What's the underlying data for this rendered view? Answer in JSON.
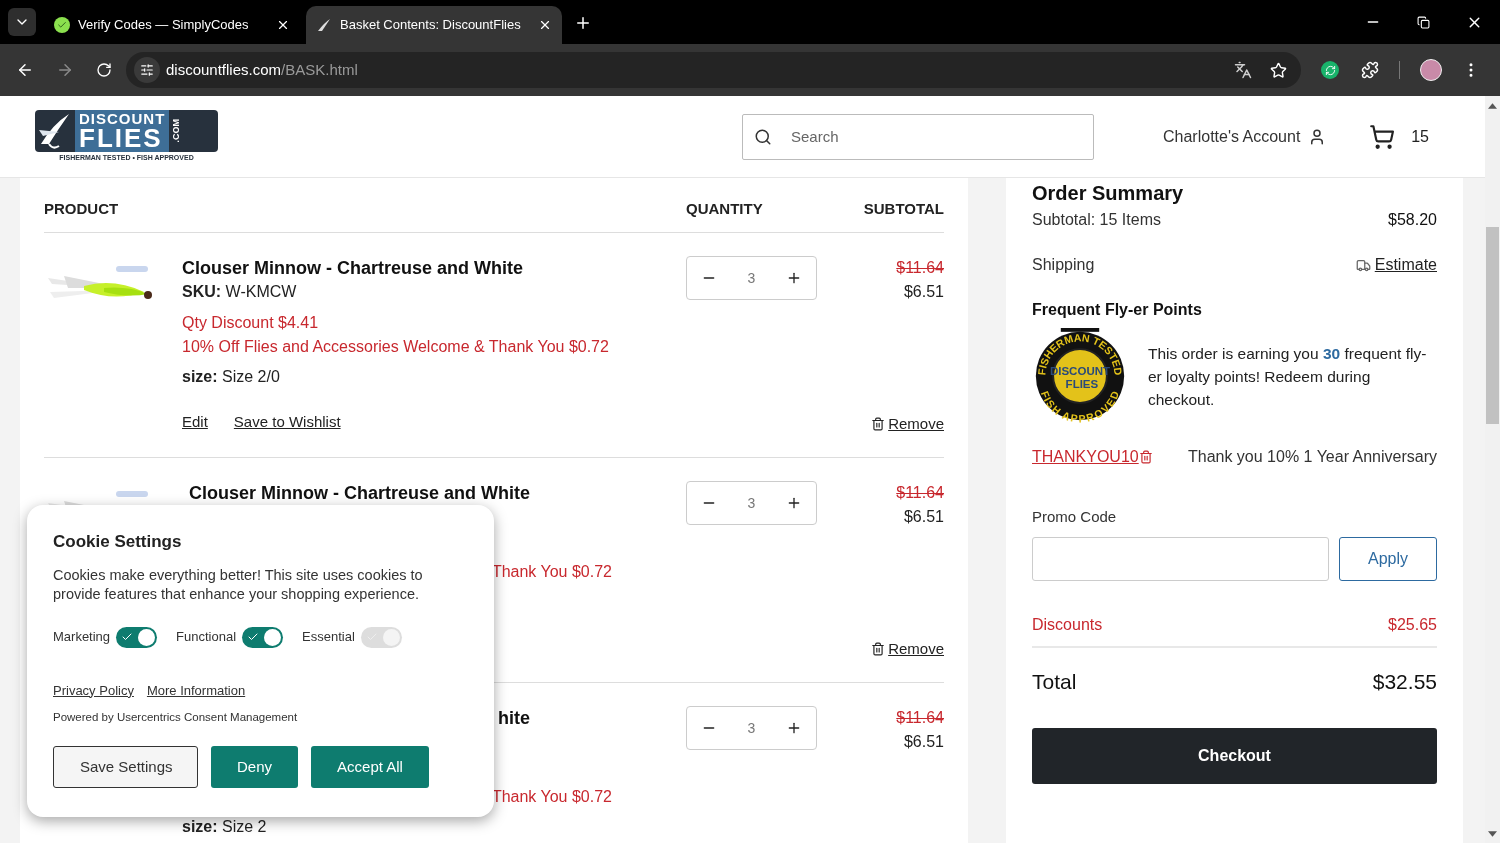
{
  "browser": {
    "tabs": [
      {
        "title": "Verify Codes — SimplyCodes",
        "selected": false
      },
      {
        "title": "Basket Contents: DiscountFlies",
        "selected": true
      }
    ],
    "url": {
      "host": "discountflies.com",
      "path": "/BASK.html"
    }
  },
  "header": {
    "logo": {
      "top": "DISCOUNT",
      "main": "FLIES",
      "suffix": ".COM",
      "tagline": "FISHERMAN TESTED • FISH APPROVED"
    },
    "search": {
      "placeholder": "Search"
    },
    "account": "Charlotte's Account",
    "cart_count": "15"
  },
  "basket": {
    "columns": [
      "PRODUCT",
      "QUANTITY",
      "SUBTOTAL"
    ],
    "items": [
      {
        "image": {
          "kind": "picture"
        },
        "covered": false,
        "title": "Clouser Minnow - Chartreuse and White",
        "sku_label": "SKU:",
        "sku": "W-KMCW",
        "qty_discount": "Qty Discount $4.41",
        "promo_discount": "10% Off Flies and Accessories Welcome & Thank You $0.72",
        "size_label": "size:",
        "size": "Size 2/0",
        "actions": [
          "Edit",
          "Save to Wishlist"
        ],
        "remove": "Remove",
        "quantity": "3",
        "old_price": "$11.64",
        "price": "$6.51"
      },
      {
        "image": {
          "kind": "picture"
        },
        "covered": true,
        "title": "Clouser Minnow - Chartreuse and White",
        "promo_discount": "Thank You $0.72",
        "remove": "Remove",
        "quantity": "3",
        "old_price": "$11.64",
        "price": "$6.51"
      },
      {
        "covered": true,
        "title": "hite",
        "promo_discount": "Thank You $0.72",
        "size_label": "size:",
        "size": "Size 2",
        "quantity": "3",
        "old_price": "$11.64",
        "price": "$6.51"
      }
    ]
  },
  "summary": {
    "title": "Order Summary",
    "subtotal_label": "Subtotal: 15 Items",
    "subtotal": "$58.20",
    "shipping_label": "Shipping",
    "shipping_link": "Estimate",
    "points_title": "Frequent Fly-er Points",
    "badge": {
      "ring_top": "FISHERMAN TESTED",
      "ring_bottom": "FISH APPROVED",
      "center_top": "DISCOUNT",
      "center_bottom": "FLIES"
    },
    "points_text": [
      "This order is earning you ",
      "30",
      " frequent fly-er loyalty points! Redeem during checkout."
    ],
    "coupon": {
      "code": "THANKYOU10",
      "description": "Thank you 10% 1 Year Anniversary"
    },
    "promo_label": "Promo Code",
    "apply": "Apply",
    "discounts_label": "Discounts",
    "discounts": "$25.65",
    "total_label": "Total",
    "total": "$32.55",
    "checkout": "Checkout"
  },
  "cookie_dialog": {
    "title": "Cookie Settings",
    "text": "Cookies make everything better! This site uses cookies to provide features that enhance your shopping experience.",
    "toggles": [
      {
        "label": "Marketing",
        "on": true,
        "disabled": false
      },
      {
        "label": "Functional",
        "on": true,
        "disabled": false
      },
      {
        "label": "Essential",
        "on": true,
        "disabled": true
      }
    ],
    "links": [
      "Privacy Policy",
      "More Information"
    ],
    "powered_by": "Powered by Usercentrics Consent Management",
    "buttons": [
      {
        "label": "Save Settings",
        "kind": "outline"
      },
      {
        "label": "Deny",
        "kind": "primary"
      },
      {
        "label": "Accept All",
        "kind": "primary"
      }
    ]
  }
}
